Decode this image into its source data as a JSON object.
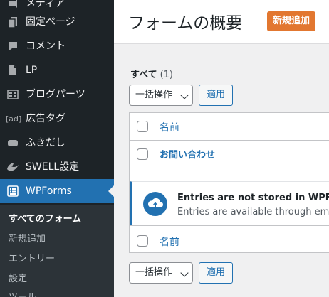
{
  "sidebar": {
    "items": [
      {
        "label": "メディア",
        "icon": "media-icon"
      },
      {
        "label": "固定ページ",
        "icon": "pages-icon"
      },
      {
        "label": "コメント",
        "icon": "comments-icon"
      },
      {
        "label": "LP",
        "icon": "document-icon"
      },
      {
        "label": "ブログパーツ",
        "icon": "grid-icon"
      },
      {
        "label": "広告タグ",
        "icon": "ad-icon"
      },
      {
        "label": "ふきだし",
        "icon": "balloon-icon"
      },
      {
        "label": "SWELL設定",
        "icon": "swell-icon"
      },
      {
        "label": "WPForms",
        "icon": "wpforms-icon"
      }
    ],
    "submenu": [
      "すべてのフォーム",
      "新規追加",
      "エントリー",
      "設定",
      "ツール"
    ]
  },
  "header": {
    "title": "フォームの概要",
    "add_new": "新規追加"
  },
  "filters": {
    "all_label": "すべて",
    "all_count": "(1)"
  },
  "tablenav": {
    "bulk_action": "一括操作",
    "apply": "適用"
  },
  "table": {
    "column_name": "名前",
    "rows": [
      {
        "title": "お問い合わせ"
      }
    ]
  },
  "notice": {
    "title": "Entries are not stored in WPForms Lite",
    "text": "Entries are available through email notifications."
  },
  "colors": {
    "sidebar_bg": "#1d2327",
    "active_blue": "#2271b1",
    "add_new_orange": "#e27730"
  }
}
